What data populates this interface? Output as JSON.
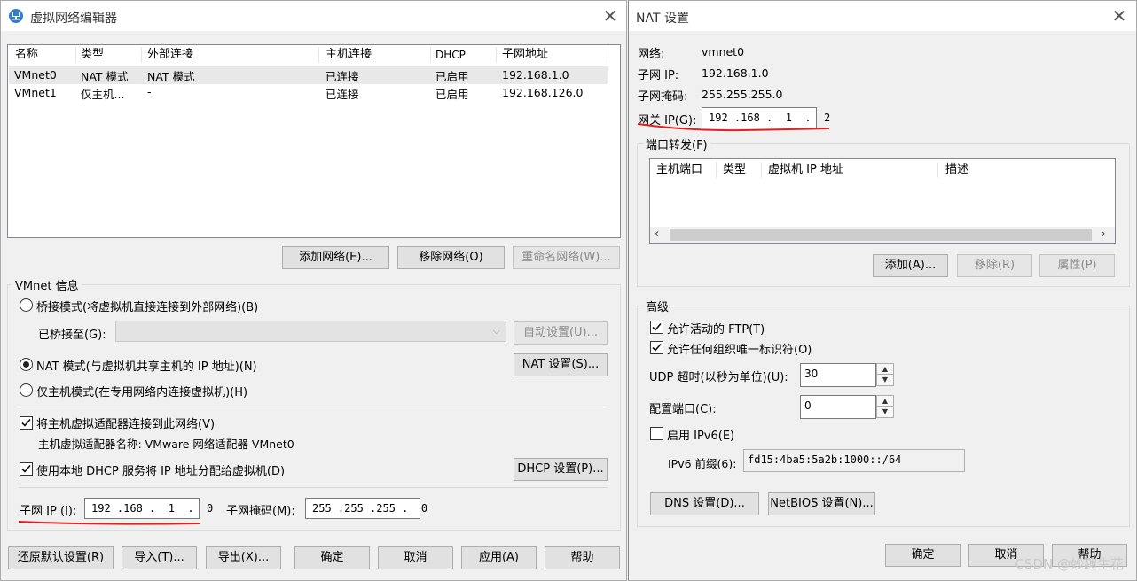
{
  "left": {
    "title": "虚拟网络编辑器",
    "table": {
      "headers": [
        "名称",
        "类型",
        "外部连接",
        "主机连接",
        "DHCP",
        "子网地址"
      ],
      "rows": [
        [
          "VMnet0",
          "NAT 模式",
          "NAT 模式",
          "已连接",
          "已启用",
          "192.168.1.0"
        ],
        [
          "VMnet1",
          "仅主机...",
          "-",
          "已连接",
          "已启用",
          "192.168.126.0"
        ]
      ]
    },
    "buttons": {
      "add_network": "添加网络(E)...",
      "remove_network": "移除网络(O)",
      "rename_network": "重命名网络(W)..."
    },
    "vmnet_info": {
      "label": "VMnet 信息",
      "bridged_radio": "桥接模式(将虚拟机直接连接到外部网络)(B)",
      "bridged_to_label": "已桥接至(G):",
      "bridged_to_value": "",
      "auto_settings": "自动设置(U)...",
      "nat_radio": "NAT 模式(与虚拟机共享主机的 IP 地址)(N)",
      "nat_settings": "NAT 设置(S)...",
      "hostonly_radio": "仅主机模式(在专用网络内连接虚拟机)(H)",
      "connect_adapter_check": "将主机虚拟适配器连接到此网络(V)",
      "adapter_name_text": "主机虚拟适配器名称: VMware 网络适配器 VMnet0",
      "dhcp_check": "使用本地 DHCP 服务将 IP 地址分配给虚拟机(D)",
      "dhcp_settings": "DHCP 设置(P)...",
      "subnet_ip_label": "子网 IP (I):",
      "subnet_ip_value": "192 .168 .  1  .  0",
      "subnet_mask_label": "子网掩码(M):",
      "subnet_mask_value": "255 .255 .255 .  0"
    },
    "footer": {
      "restore_defaults": "还原默认设置(R)",
      "import": "导入(T)...",
      "export": "导出(X)...",
      "ok": "确定",
      "cancel": "取消",
      "apply": "应用(A)",
      "help": "帮助"
    }
  },
  "right": {
    "title": "NAT 设置",
    "network_label": "网络:",
    "network_value": "vmnet0",
    "subnet_ip_label": "子网 IP:",
    "subnet_ip_value": "192.168.1.0",
    "subnet_mask_label": "子网掩码:",
    "subnet_mask_value": "255.255.255.0",
    "gateway_label": "网关 IP(G):",
    "gateway_value": "192 .168 .  1  .  2",
    "port_forwarding": {
      "label": "端口转发(F)",
      "headers": [
        "主机端口",
        "类型",
        "虚拟机 IP 地址",
        "描述"
      ],
      "add": "添加(A)...",
      "remove": "移除(R)",
      "properties": "属性(P)"
    },
    "advanced": {
      "label": "高级",
      "allow_ftp": "允许活动的 FTP(T)",
      "allow_any_oui": "允许任何组织唯一标识符(O)",
      "udp_timeout_label": "UDP 超时(以秒为单位)(U):",
      "udp_timeout_value": "30",
      "config_port_label": "配置端口(C):",
      "config_port_value": "0",
      "enable_ipv6": "启用 IPv6(E)",
      "ipv6_prefix_label": "IPv6 前缀(6):",
      "ipv6_prefix_value": "fd15:4ba5:5a2b:1000::/64",
      "dns_settings": "DNS 设置(D)...",
      "netbios_settings": "NetBIOS 设置(N)..."
    },
    "footer": {
      "ok": "确定",
      "cancel": "取消",
      "help": "帮助"
    },
    "watermark": "CSDN @妙趣生花"
  }
}
